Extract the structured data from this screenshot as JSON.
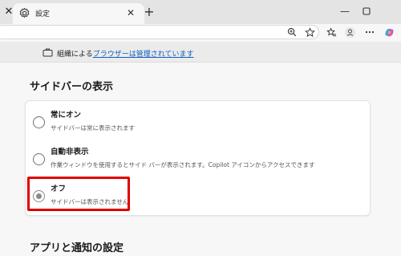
{
  "browser": {
    "tab_title": "設定",
    "icons": {
      "tab_close_left": "close-icon",
      "tab_favicon": "gear-icon",
      "tab_close": "close-icon",
      "new_tab": "plus-icon",
      "minimize": "minimize-icon",
      "maximize": "maximize-icon"
    },
    "toolbar_icons": [
      "zoom-icon",
      "star-icon",
      "favorites-icon",
      "profile-icon",
      "more-icon",
      "copilot-icon"
    ]
  },
  "banner": {
    "prefix": "組織による",
    "link": "ブラウザーは管理されています"
  },
  "sidebar_section": {
    "title": "サイドバーの表示",
    "options": [
      {
        "label": "常にオン",
        "description": "サイドバーは常に表示されます",
        "selected": false
      },
      {
        "label": "自動非表示",
        "description": "作業ウィンドウを使用するとサイド バーが表示されます。Copilot アイコンからアクセスできます",
        "selected": false
      },
      {
        "label": "オフ",
        "description": "サイドバーは表示されません",
        "selected": true
      }
    ]
  },
  "next_section": {
    "title": "アプリと通知の設定"
  },
  "colors": {
    "highlight": "#e00000",
    "link": "#0f5fbe"
  }
}
